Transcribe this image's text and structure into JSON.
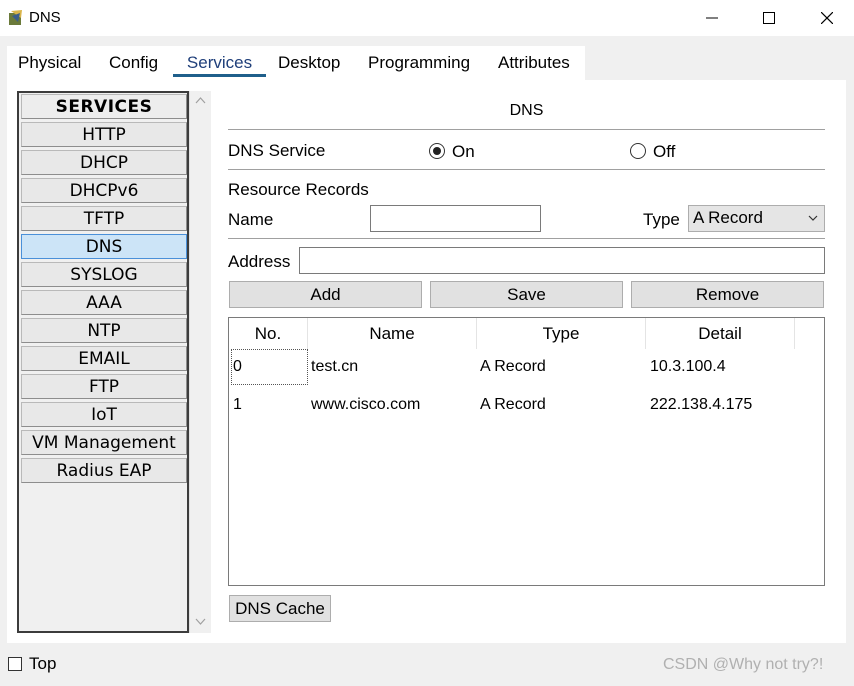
{
  "window": {
    "title": "DNS",
    "icons": {
      "app": "packet-tracer-device-icon",
      "minimize": "minimize-icon",
      "maximize": "maximize-icon",
      "close": "close-icon"
    }
  },
  "tabs": [
    "Physical",
    "Config",
    "Services",
    "Desktop",
    "Programming",
    "Attributes"
  ],
  "active_tab": "Services",
  "services": {
    "header": "SERVICES",
    "items": [
      "HTTP",
      "DHCP",
      "DHCPv6",
      "TFTP",
      "DNS",
      "SYSLOG",
      "AAA",
      "NTP",
      "EMAIL",
      "FTP",
      "IoT",
      "VM Management",
      "Radius EAP"
    ],
    "selected": "DNS"
  },
  "dns": {
    "title": "DNS",
    "service_label": "DNS Service",
    "on_label": "On",
    "off_label": "Off",
    "service_state": "On",
    "resource_records_label": "Resource Records",
    "name_label": "Name",
    "name_value": "",
    "type_label": "Type",
    "type_value": "A Record",
    "address_label": "Address",
    "address_value": "",
    "buttons": {
      "add": "Add",
      "save": "Save",
      "remove": "Remove"
    },
    "table": {
      "columns": [
        "No.",
        "Name",
        "Type",
        "Detail"
      ],
      "rows": [
        {
          "no": "0",
          "name": "test.cn",
          "type": "A Record",
          "detail": "10.3.100.4"
        },
        {
          "no": "1",
          "name": "www.cisco.com",
          "type": "A Record",
          "detail": "222.138.4.175"
        }
      ]
    },
    "cache_button": "DNS Cache"
  },
  "footer": {
    "top_label": "Top",
    "top_checked": false,
    "watermark": "CSDN @Why not try?!"
  },
  "colors": {
    "selected_item": "#cce4f7",
    "active_tab_underline": "#1f5f8b"
  }
}
